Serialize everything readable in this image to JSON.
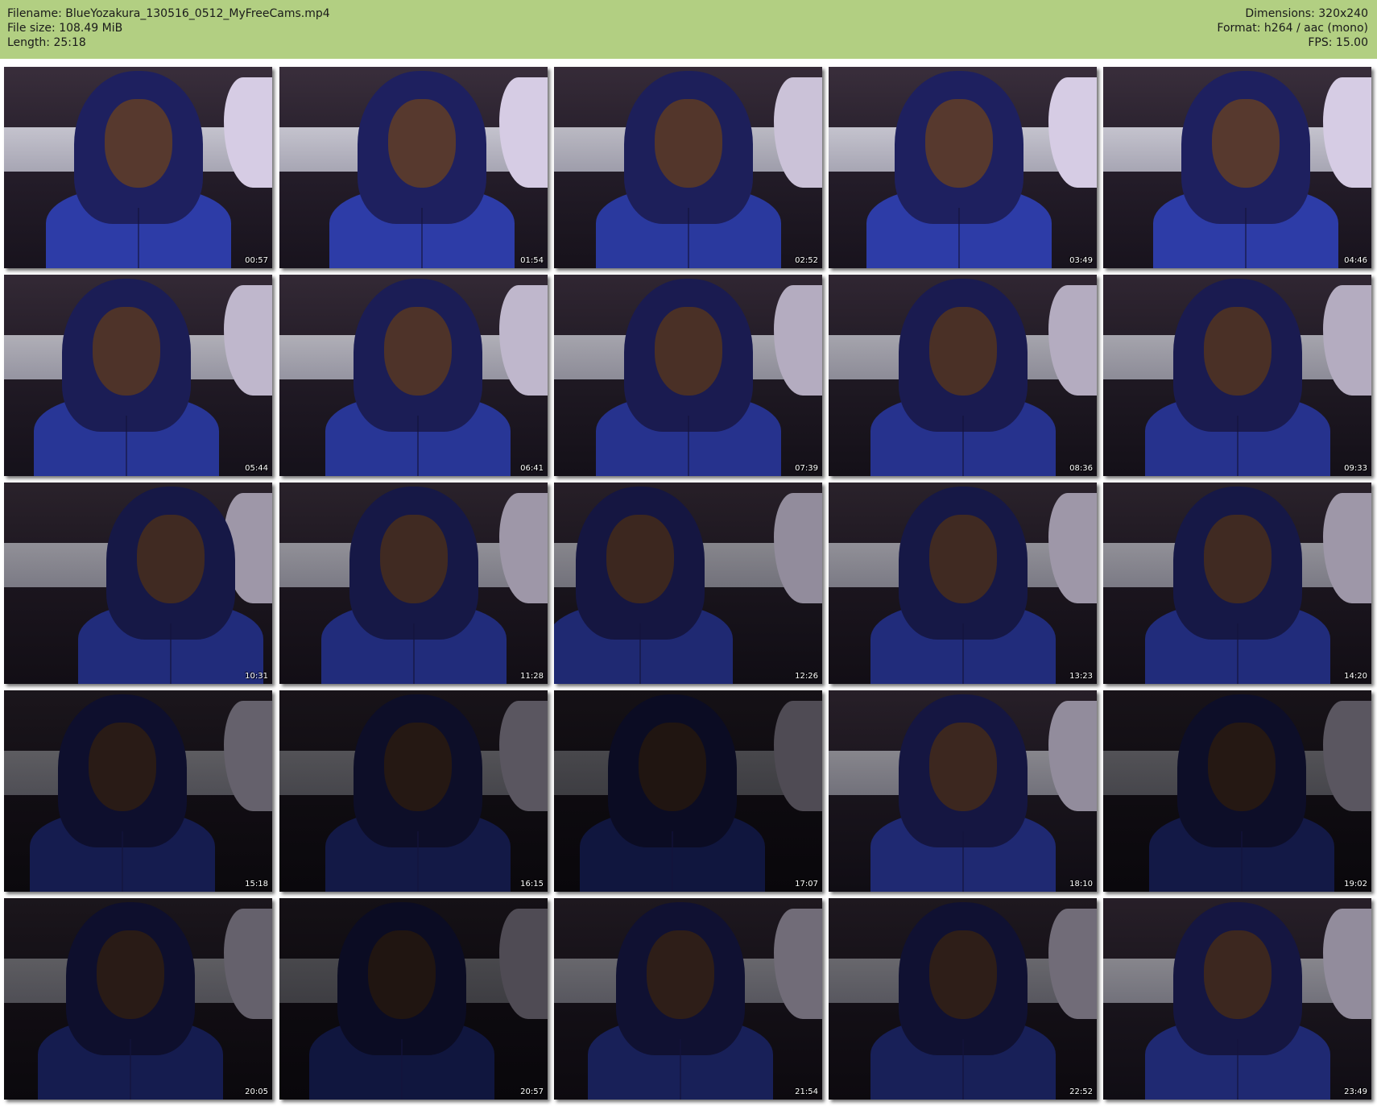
{
  "header": {
    "filename_line": "Filename: BlueYozakura_130516_0512_MyFreeCams.mp4",
    "filesize_line": "File size: 108.49 MiB",
    "length_line": "Length: 25:18",
    "dimensions_line": "Dimensions: 320x240",
    "format_line": "Format: h264 / aac (mono)",
    "fps_line": "FPS: 15.00"
  },
  "colors": {
    "header_bg": "#b2cf82",
    "jacket_blue": "#2f3fb0",
    "timestamp_text": "#ffffff"
  },
  "thumbnails": [
    {
      "timestamp": "00:57"
    },
    {
      "timestamp": "01:54"
    },
    {
      "timestamp": "02:52"
    },
    {
      "timestamp": "03:49"
    },
    {
      "timestamp": "04:46"
    },
    {
      "timestamp": "05:44"
    },
    {
      "timestamp": "06:41"
    },
    {
      "timestamp": "07:39"
    },
    {
      "timestamp": "08:36"
    },
    {
      "timestamp": "09:33"
    },
    {
      "timestamp": "10:31"
    },
    {
      "timestamp": "11:28"
    },
    {
      "timestamp": "12:26"
    },
    {
      "timestamp": "13:23"
    },
    {
      "timestamp": "14:20"
    },
    {
      "timestamp": "15:18"
    },
    {
      "timestamp": "16:15"
    },
    {
      "timestamp": "17:07"
    },
    {
      "timestamp": "18:10"
    },
    {
      "timestamp": "19:02"
    },
    {
      "timestamp": "20:05"
    },
    {
      "timestamp": "20:57"
    },
    {
      "timestamp": "21:54"
    },
    {
      "timestamp": "22:52"
    },
    {
      "timestamp": "23:49"
    }
  ]
}
